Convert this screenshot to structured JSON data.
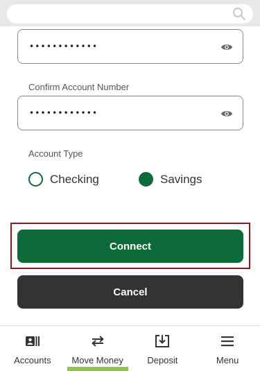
{
  "search": {
    "icon": "search-icon"
  },
  "account_number": {
    "masked_value": "••••••••••••",
    "icon": "eye-icon"
  },
  "confirm_account_number": {
    "label": "Confirm Account Number",
    "masked_value": "••••••••••••",
    "icon": "eye-icon"
  },
  "account_type": {
    "label": "Account Type",
    "options": [
      {
        "label": "Checking",
        "selected": false
      },
      {
        "label": "Savings",
        "selected": true
      }
    ]
  },
  "buttons": {
    "connect": "Connect",
    "cancel": "Cancel"
  },
  "colors": {
    "primary_green": "#0d6b3a",
    "cancel_dark": "#333333",
    "highlight_border": "#8b1a1a",
    "active_tab_underline": "#8dc63f"
  },
  "bottom_nav": {
    "items": [
      {
        "label": "Accounts",
        "icon": "accounts-icon",
        "active": false
      },
      {
        "label": "Move Money",
        "icon": "transfer-arrows-icon",
        "active": true
      },
      {
        "label": "Deposit",
        "icon": "deposit-icon",
        "active": false
      },
      {
        "label": "Menu",
        "icon": "hamburger-menu-icon",
        "active": false
      }
    ]
  }
}
